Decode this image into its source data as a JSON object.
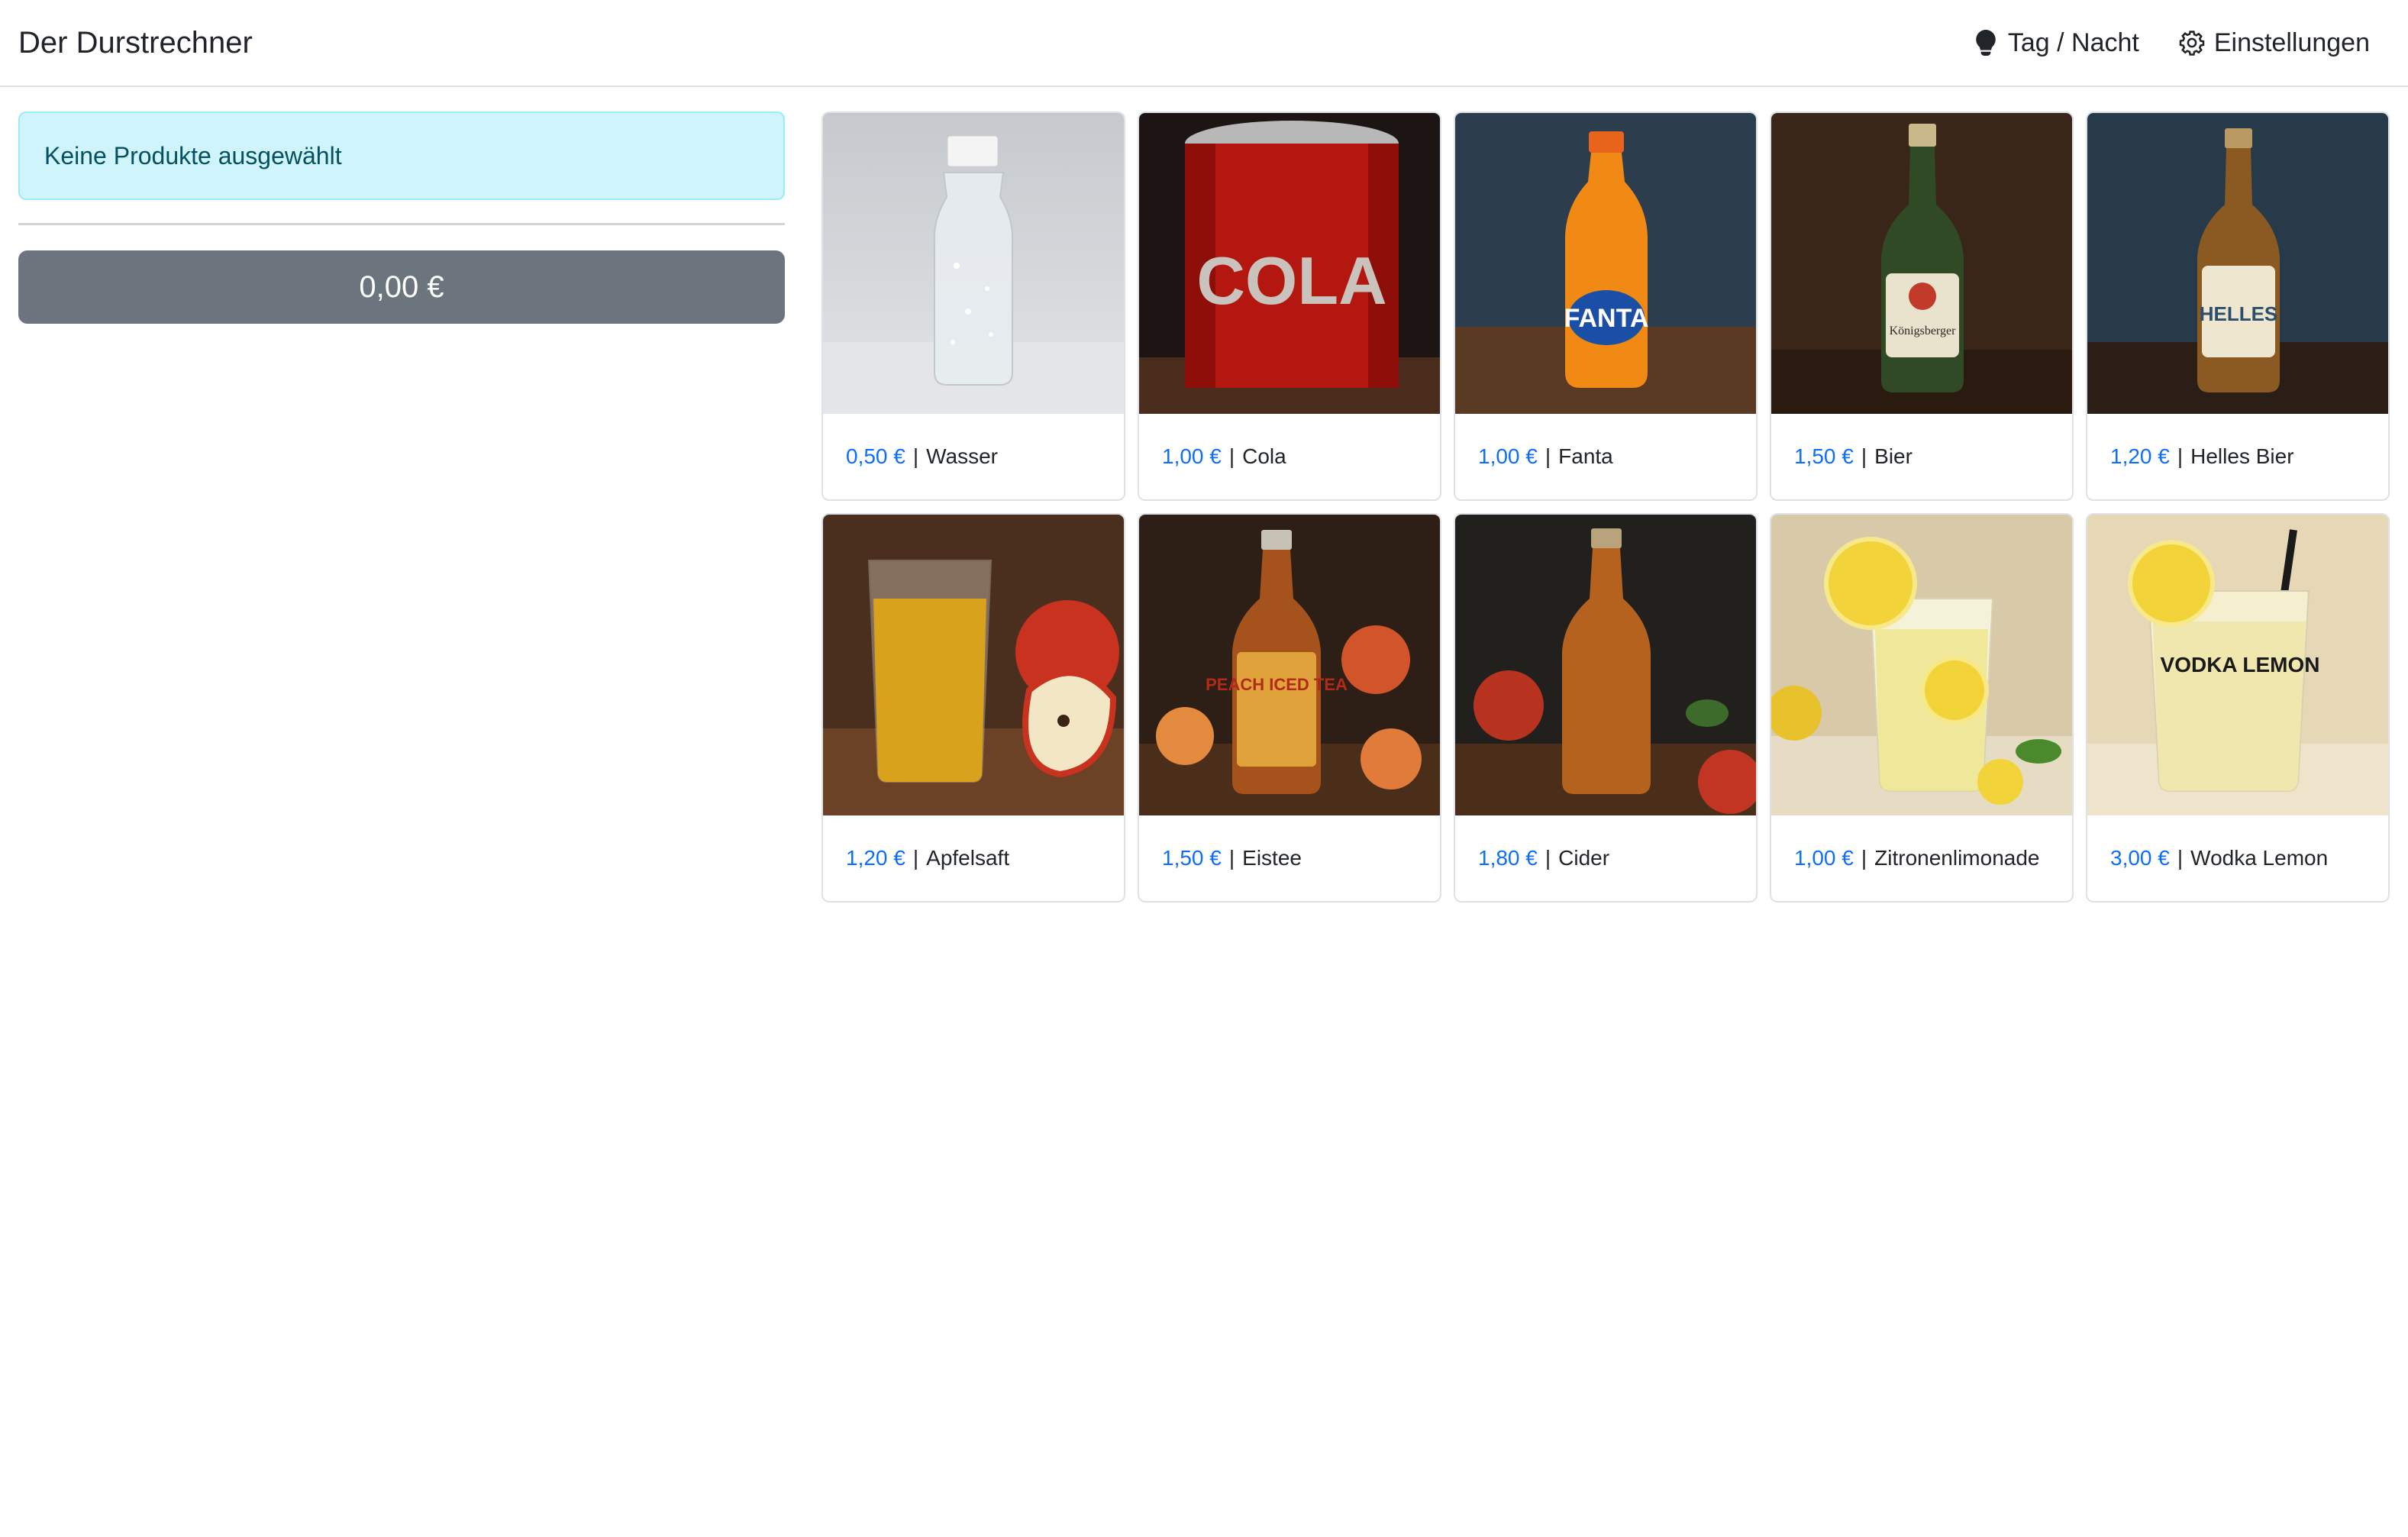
{
  "navbar": {
    "brand": "Der Durstrechner",
    "theme_toggle_label": "Tag / Nacht",
    "settings_label": "Einstellungen"
  },
  "cart": {
    "empty_message": "Keine Produkte ausgewählt",
    "total": "0,00 €"
  },
  "colors": {
    "accent": "#0d6efd",
    "alert_bg": "#cff4fc",
    "alert_text": "#055160",
    "total_button": "#6c757d"
  },
  "separator": "|",
  "products": [
    {
      "price": "0,50 €",
      "name": "Wasser",
      "icon": "water-bottle-image"
    },
    {
      "price": "1,00 €",
      "name": "Cola",
      "icon": "cola-can-image",
      "label_text": "COLA"
    },
    {
      "price": "1,00 €",
      "name": "Fanta",
      "icon": "fanta-bottle-image",
      "label_text": "FANTA"
    },
    {
      "price": "1,50 €",
      "name": "Bier",
      "icon": "beer-bottle-image",
      "label_text": "Königsberger"
    },
    {
      "price": "1,20 €",
      "name": "Helles Bier",
      "icon": "helles-bottle-image",
      "label_text": "HELLES"
    },
    {
      "price": "1,20 €",
      "name": "Apfelsaft",
      "icon": "apple-juice-image"
    },
    {
      "price": "1,50 €",
      "name": "Eistee",
      "icon": "iced-tea-bottle-image",
      "label_text": "PEACH ICED TEA"
    },
    {
      "price": "1,80 €",
      "name": "Cider",
      "icon": "cider-bottle-image"
    },
    {
      "price": "1,00 €",
      "name": "Zitronenlimonade",
      "icon": "lemonade-glass-image"
    },
    {
      "price": "3,00 €",
      "name": "Wodka Lemon",
      "icon": "vodka-lemon-glass-image",
      "label_text": "VODKA LEMON"
    }
  ]
}
